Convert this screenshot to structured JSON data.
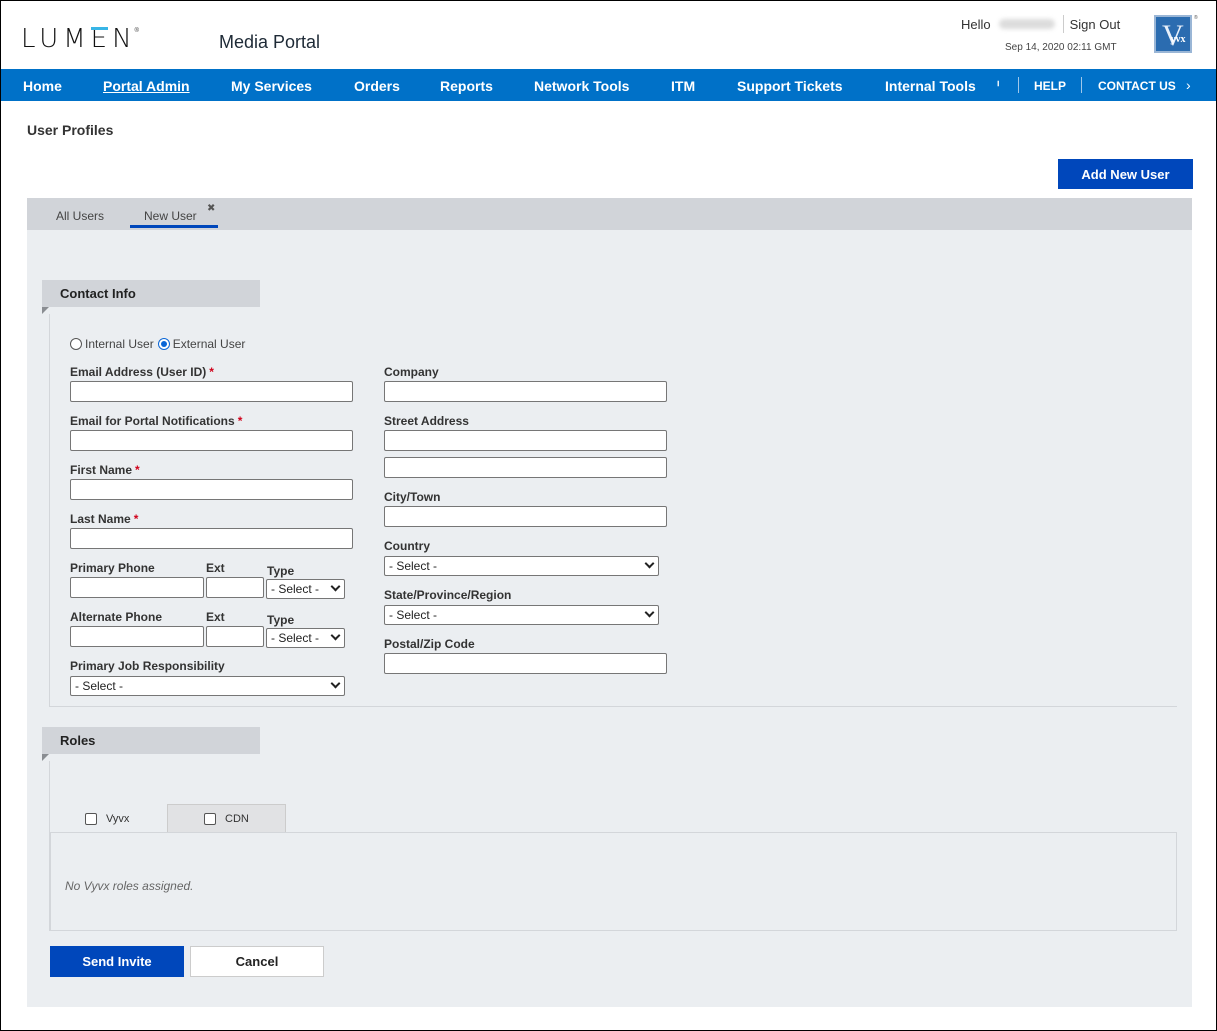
{
  "header": {
    "brand": "LUMEN",
    "app_title": "Media Portal",
    "hello_label": "Hello",
    "sign_out": "Sign Out",
    "datetime": "Sep 14, 2020 02:11 GMT",
    "partner_logo": "VYVX"
  },
  "nav": {
    "items": [
      "Home",
      "Portal Admin",
      "My Services",
      "Orders",
      "Reports",
      "Network Tools",
      "ITM",
      "Support Tickets",
      "Internal Tools"
    ],
    "active": "Portal Admin",
    "overflow_glyph": "ᑊ",
    "help": "HELP",
    "contact": "CONTACT US",
    "contact_chevron": "›"
  },
  "page": {
    "title": "User Profiles",
    "add_user_button": "Add New User",
    "tabs": [
      "All Users",
      "New User"
    ],
    "active_tab": "New User",
    "tab_close": "✖"
  },
  "contact_info": {
    "heading": "Contact Info",
    "user_type_options": [
      "Internal User",
      "External User"
    ],
    "user_type_selected": "External User",
    "left": {
      "email_label": "Email Address (User ID)",
      "notify_email_label": "Email for Portal Notifications",
      "first_name_label": "First Name",
      "last_name_label": "Last Name",
      "primary_phone_label": "Primary Phone",
      "alternate_phone_label": "Alternate Phone",
      "ext_label": "Ext",
      "type_label": "Type",
      "type_value": "- Select -",
      "job_label": "Primary Job Responsibility",
      "job_value": "- Select -",
      "required_marker": "*"
    },
    "right": {
      "company_label": "Company",
      "street_label": "Street Address",
      "city_label": "City/Town",
      "country_label": "Country",
      "country_value": "- Select -",
      "state_label": "State/Province/Region",
      "state_value": "- Select -",
      "postal_label": "Postal/Zip Code"
    }
  },
  "roles": {
    "heading": "Roles",
    "tabs": [
      {
        "label": "Vyvx",
        "checked": false
      },
      {
        "label": "CDN",
        "checked": false
      }
    ],
    "empty_message": "No Vyvx roles assigned."
  },
  "actions": {
    "send": "Send Invite",
    "cancel": "Cancel"
  },
  "colors": {
    "nav_blue": "#0071c8",
    "primary_button": "#0047bb",
    "required": "#d0021b",
    "lumen_accent": "#38b5e6"
  }
}
